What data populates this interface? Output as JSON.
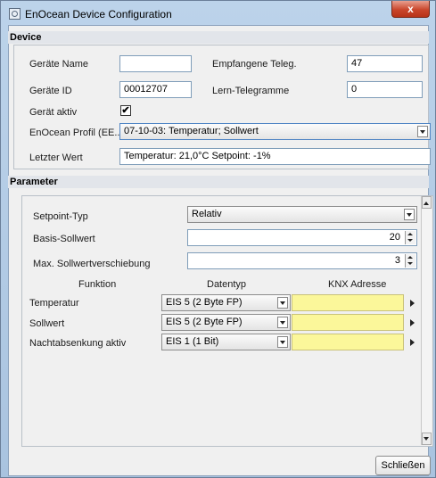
{
  "window": {
    "title": "EnOcean Device Configuration",
    "close_glyph": "x"
  },
  "device": {
    "section_title": "Device",
    "name_label": "Geräte Name",
    "name_value": "",
    "received_label": "Empfangene Teleg.",
    "received_value": "47",
    "id_label": "Geräte ID",
    "id_value": "00012707",
    "learn_label": "Lern-Telegramme",
    "learn_value": "0",
    "active_label": "Gerät aktiv",
    "active_checked": "✔",
    "profile_label": "EnOcean Profil (EE...",
    "profile_value": "07-10-03: Temperatur; Sollwert",
    "last_value_label": "Letzter Wert",
    "last_value": "Temperatur: 21,0°C Setpoint: -1%"
  },
  "parameter": {
    "section_title": "Parameter",
    "setpoint_type_label": "Setpoint-Typ",
    "setpoint_type_value": "Relativ",
    "base_setpoint_label": "Basis-Sollwert",
    "base_setpoint_value": "20",
    "max_shift_label": "Max. Sollwertverschiebung",
    "max_shift_value": "3",
    "table": {
      "columns": [
        "Funktion",
        "Datentyp",
        "KNX Adresse"
      ],
      "rows": [
        {
          "function": "Temperatur",
          "datatype": "EIS 5 (2 Byte FP)",
          "address": ""
        },
        {
          "function": "Sollwert",
          "datatype": "EIS 5 (2 Byte FP)",
          "address": ""
        },
        {
          "function": "Nachtabsenkung aktiv",
          "datatype": "EIS 1 (1 Bit)",
          "address": ""
        }
      ]
    }
  },
  "footer": {
    "close_button": "Schließen"
  },
  "colors": {
    "knx_field": "#fbf79a",
    "titlebar": "#bcd3ea",
    "close_button": "#c9462c"
  }
}
